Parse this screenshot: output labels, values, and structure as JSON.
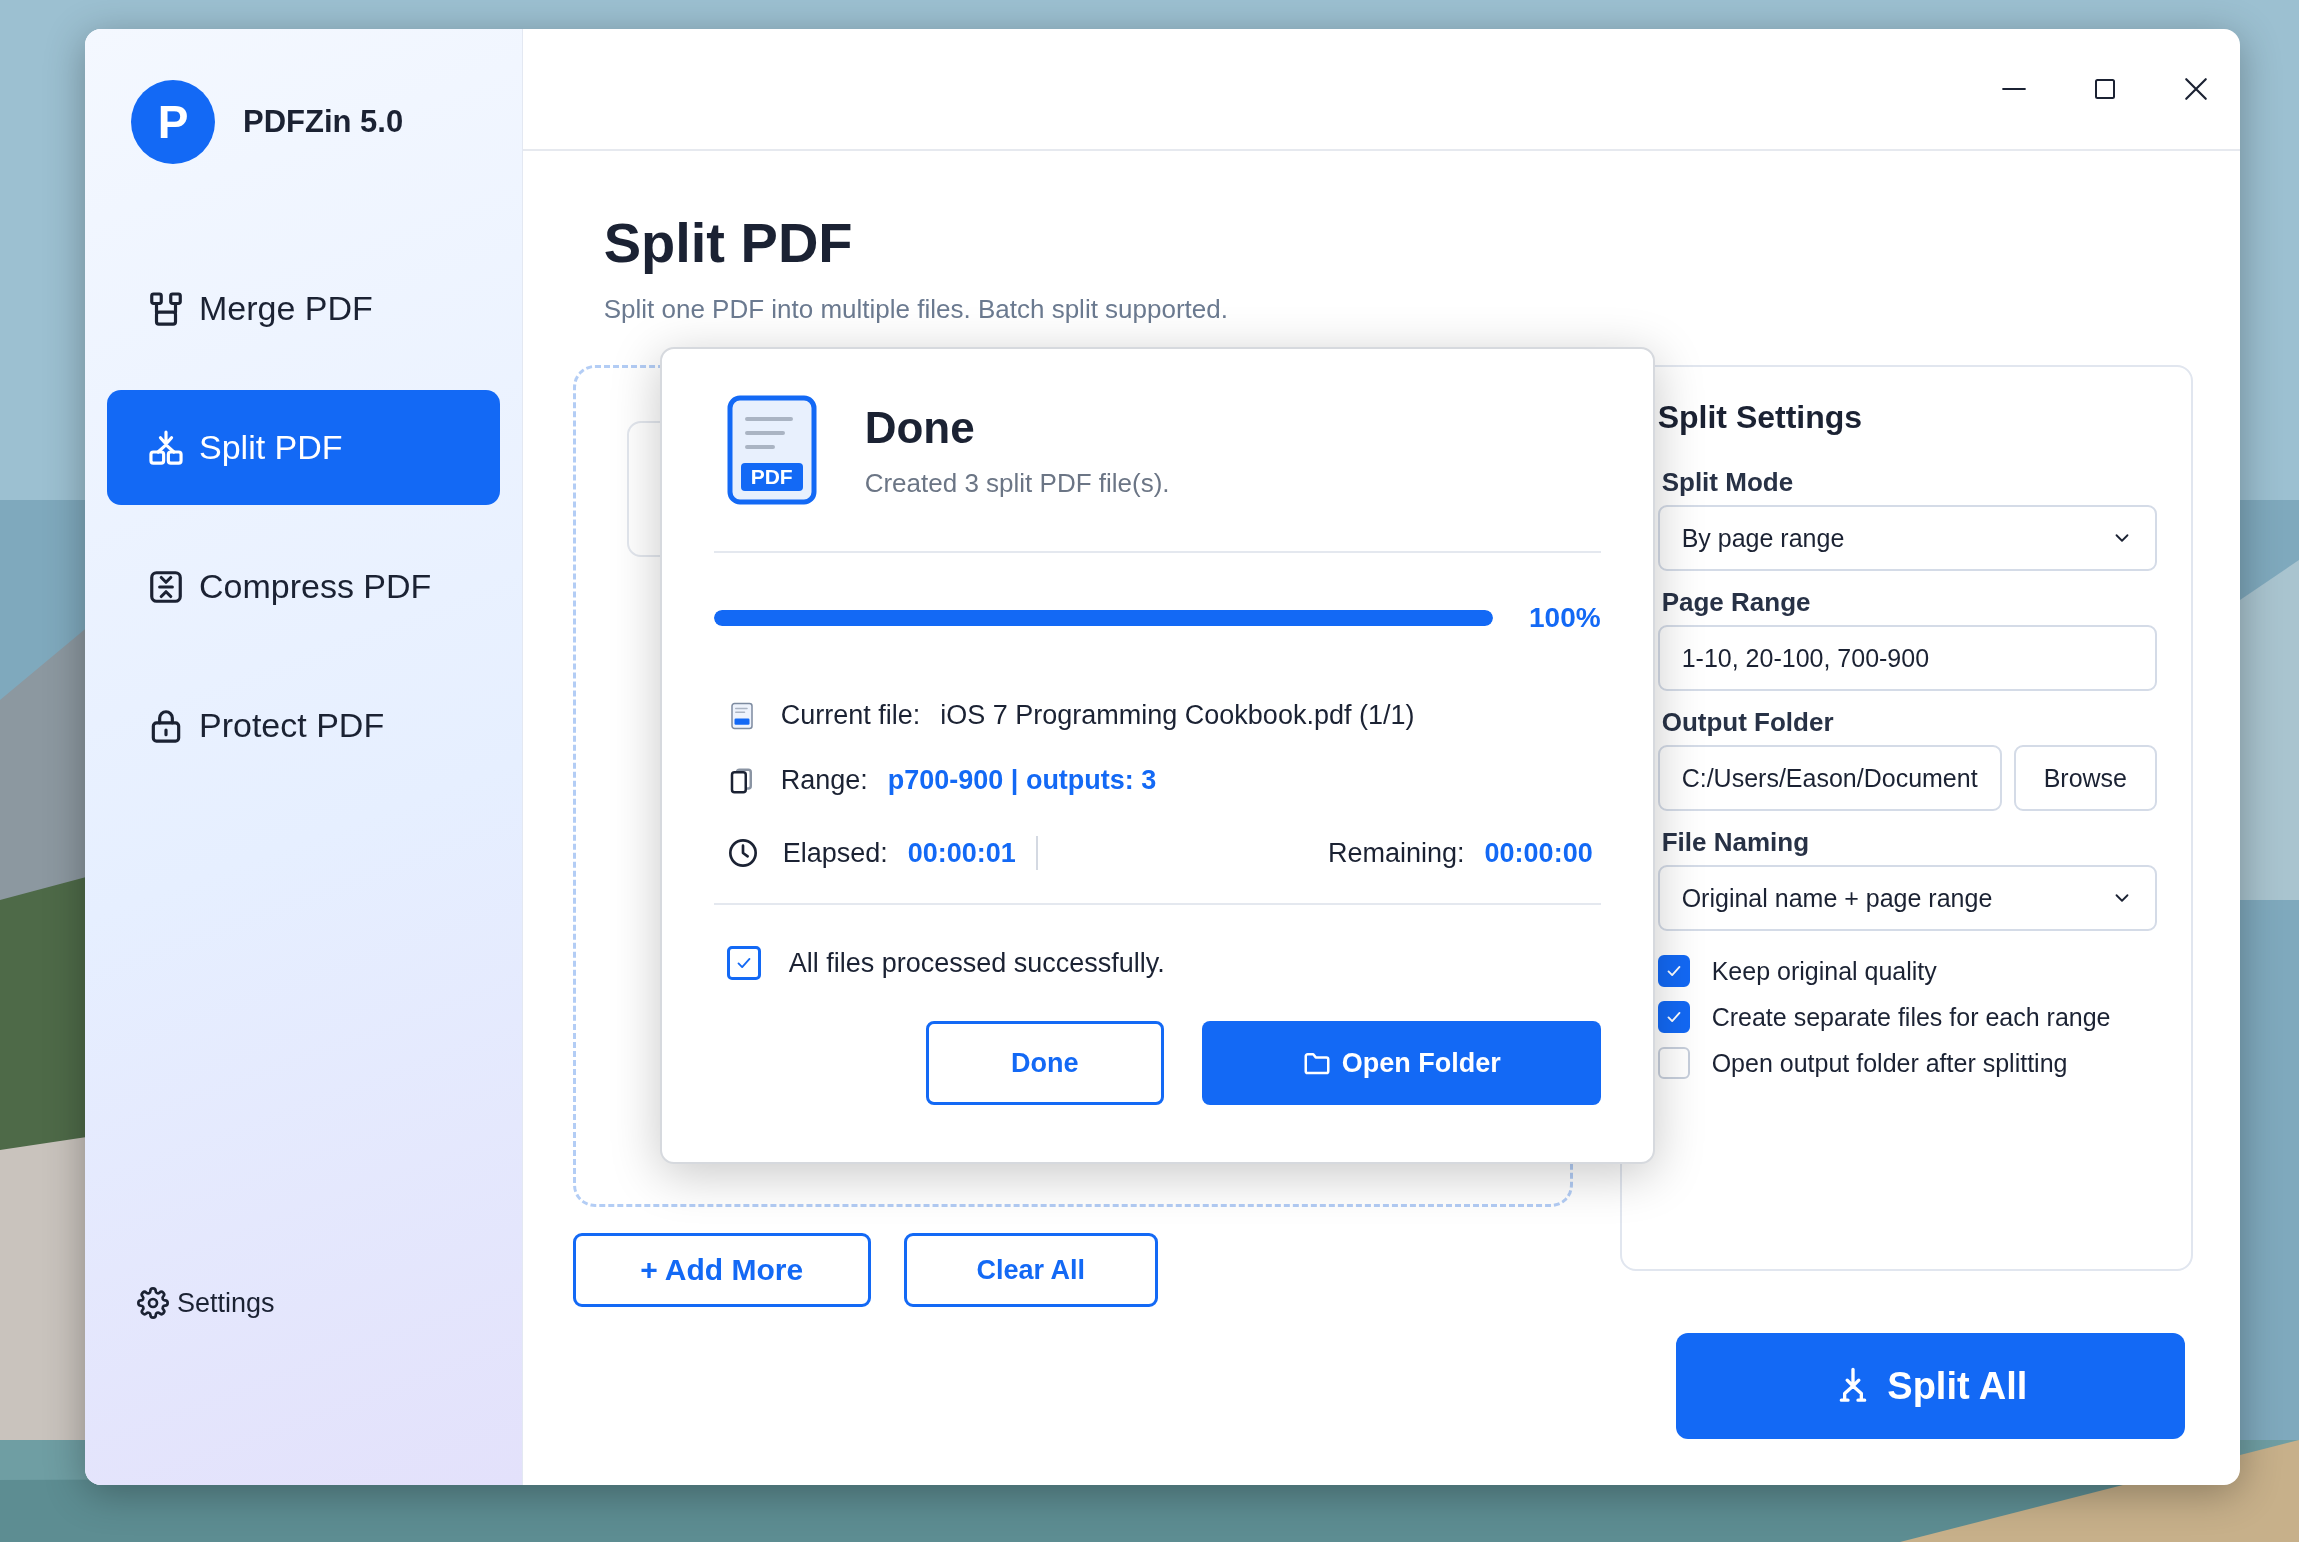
{
  "app": {
    "logo_letter": "P",
    "name": "PDFZin 5.0"
  },
  "nav": [
    {
      "kind": "merge",
      "label": "Merge PDF",
      "selected": false
    },
    {
      "kind": "split",
      "label": "Split PDF",
      "selected": true
    },
    {
      "kind": "compress",
      "label": "Compress PDF",
      "selected": false
    },
    {
      "kind": "protect",
      "label": "Protect PDF",
      "selected": false
    }
  ],
  "settings_link": {
    "label": "Settings"
  },
  "page": {
    "title": "Split PDF",
    "subtitle": "Split one PDF into multiple files. Batch split supported."
  },
  "file_buttons": [
    {
      "kind": "add",
      "label": "+ Add More"
    },
    {
      "kind": "clear",
      "label": "Clear All"
    }
  ],
  "split_settings": {
    "title": "Split Settings",
    "fields": [
      {
        "kind": "select",
        "label": "Split Mode",
        "value": "By page range"
      },
      {
        "kind": "text",
        "label": "Page Range",
        "value": "1-10, 20-100, 700-900"
      },
      {
        "kind": "folder",
        "label": "Output Folder",
        "value": "C:/Users/Eason/Document",
        "button": "Browse"
      },
      {
        "kind": "select",
        "label": "File Naming",
        "value": "Original name + page range"
      }
    ],
    "options": [
      {
        "label": "Keep original quality",
        "checked": true
      },
      {
        "label": "Create separate files for each range",
        "checked": true
      },
      {
        "label": "Open output folder after splitting",
        "checked": false
      }
    ]
  },
  "split_button": {
    "label": "Split All"
  },
  "dialog": {
    "icon_label": "PDF",
    "title": "Done",
    "message": "Created 3 split PDF file(s).",
    "progress": {
      "level": 1.0,
      "reading": "100%"
    },
    "details": [
      {
        "kind": "file",
        "label": "Current file:",
        "value": "iOS 7 Programming Cookbook.pdf (1/1)",
        "highlight": false
      },
      {
        "kind": "pages",
        "label": "Range:",
        "value": "p700-900 | outputs: 3",
        "highlight": true
      }
    ],
    "timing": [
      {
        "label": "Elapsed:",
        "value": "00:00:01"
      },
      {
        "label": "Remaining:",
        "value": "00:00:00"
      }
    ],
    "status": {
      "checked": true,
      "text": "All files processed successfully."
    },
    "buttons": [
      {
        "kind": "outline",
        "label": "Done"
      },
      {
        "kind": "primary",
        "label": "Open Folder"
      }
    ]
  }
}
